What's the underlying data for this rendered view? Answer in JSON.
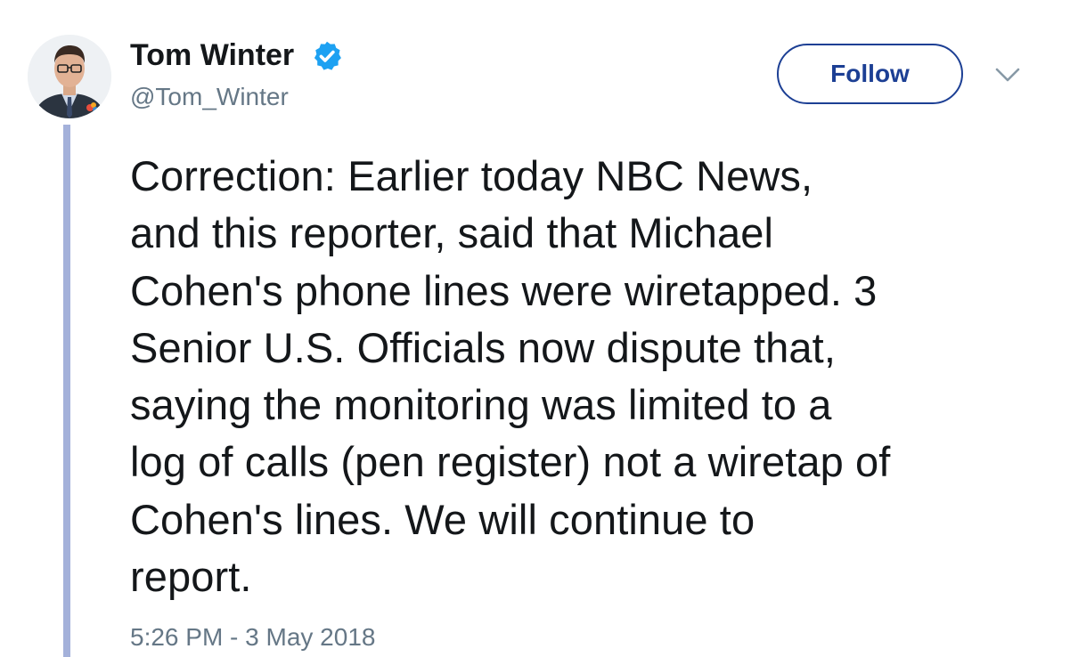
{
  "tweet": {
    "author": {
      "display_name": "Tom Winter",
      "handle": "@Tom_Winter",
      "verified": true
    },
    "follow_label": "Follow",
    "text_lines": [
      "Correction: Earlier today NBC News,",
      "and this reporter, said that Michael",
      "Cohen's phone lines were wiretapped. 3",
      "Senior U.S. Officials now dispute that,",
      "saying the monitoring was limited to a",
      "log of calls (pen register) not a wiretap of",
      "Cohen's lines. We will continue to",
      "report."
    ],
    "timestamp": "5:26 PM - 3 May 2018"
  },
  "icons": {
    "verified": "verified-badge-icon",
    "more": "chevron-down-icon"
  },
  "colors": {
    "follow_accent": "#1c3f94",
    "verified_blue": "#1da1f2",
    "thread_line": "#a4b1da",
    "secondary_text": "#657786",
    "primary_text": "#14171a"
  }
}
